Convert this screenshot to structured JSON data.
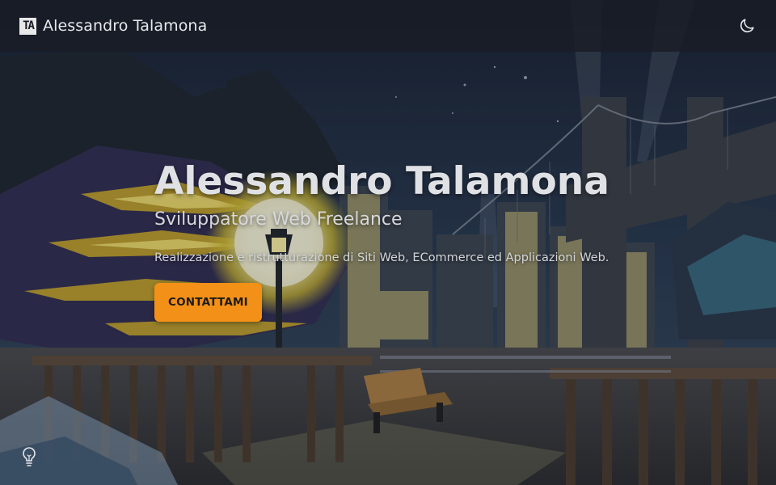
{
  "navbar": {
    "logo_text": "TA",
    "brand_name": "Alessandro Talamona",
    "theme_toggle_icon": "moon-icon"
  },
  "hero": {
    "title": "Alessandro Talamona",
    "subtitle": "Sviluppatore Web Freelance",
    "description": "Realizzazione e ristrutturazione di Siti Web, ECommerce ed Applicazioni Web.",
    "cta_label": "CONTATTAMI"
  },
  "bottom": {
    "hint_icon": "lightbulb-icon"
  },
  "colors": {
    "accent": "#f39017",
    "navbar_bg": "#181c26",
    "text": "#dfe1e4"
  }
}
